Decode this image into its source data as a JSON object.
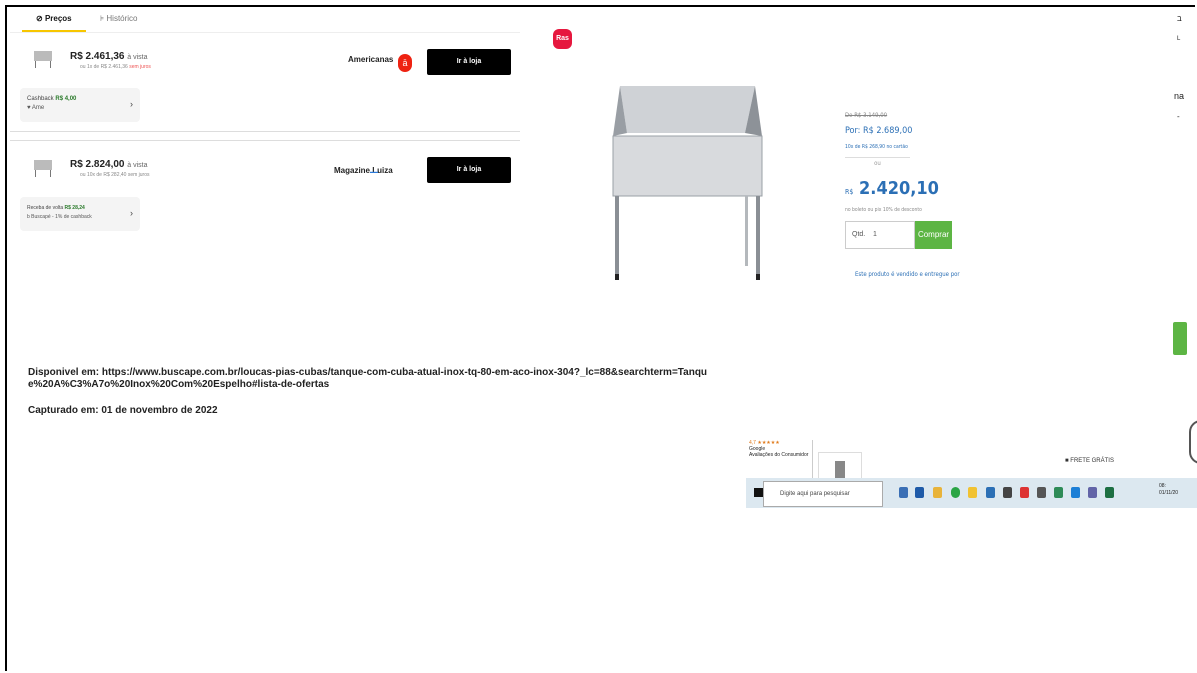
{
  "tabs": {
    "precos": "Preços",
    "historico": "Histórico"
  },
  "offers": [
    {
      "price": "R$ 2.461,36",
      "price_suffix": "à vista",
      "installments": "ou 1x de R$ 2.461,36",
      "installments_note": "sem juros",
      "store": "Americanas",
      "button": "Ir à loja",
      "cash_label": "Cashback",
      "cash_value": "R$ 4,00",
      "cash_sub": "Ame"
    },
    {
      "price": "R$ 2.824,00",
      "price_suffix": "à vista",
      "installments": "ou 10x de R$ 282,40 sem juros",
      "store": "Magazine Luiza",
      "button": "Ir à loja",
      "cash_label": "Receba de volta",
      "cash_value": "R$ 28,24",
      "cash_sub": "Buscapé - 1% de cashback"
    }
  ],
  "product": {
    "logo_text": "Ras",
    "old_price": "De R$ 3.149,00",
    "por_price": "Por: R$ 2.689,00",
    "installments": "10x de R$ 268,90 no cartão",
    "ou": "ou",
    "big_currency": "R$",
    "big_price": "2.420,10",
    "discount": "no boleto ou pix 10% de desconto",
    "qty_label": "Qtd.",
    "qty_value": "1",
    "buy_label": "Comprar",
    "return_text": "Este produto é vendido e entregue por"
  },
  "right_edge": {
    "r1": "ב",
    "r2": "L",
    "r3": "na",
    "r4": "-"
  },
  "caption": {
    "available": "Disponivel em: https://www.buscape.com.br/loucas-pias-cubas/tanque-com-cuba-atual-inox-tq-80-em-aco-inox-304?_lc=88&searchterm=Tanque%20A%C3%A7o%20Inox%20Com%20Espelho#lista-de-ofertas",
    "captured": "Capturado em: 01 de novembro de 2022"
  },
  "rating": {
    "stars": "4,7 ★★★★★",
    "google": "Google",
    "label": "Avaliações do Consumidor"
  },
  "frete": "FRETE GRÁTIS",
  "taskbar": {
    "search_placeholder": "Digite aqui para pesquisar",
    "time": "08:",
    "date": "01/11/20"
  }
}
